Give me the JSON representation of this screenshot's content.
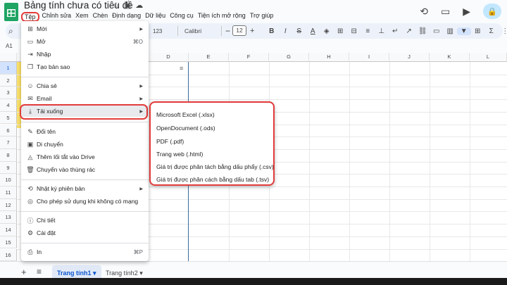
{
  "title_bar": {
    "doc_title": "Bảng tính chưa có tiêu đề",
    "icons": [
      "star-icon",
      "move-folder-icon",
      "cloud-icon"
    ],
    "right_icons": [
      "history-icon",
      "comment-icon",
      "video-icon",
      "lock-icon"
    ]
  },
  "menubar": [
    "Tệp",
    "Chỉnh sửa",
    "Xem",
    "Chèn",
    "Định dạng",
    "Dữ liệu",
    "Công cụ",
    "Tiện ích mở rộng",
    "Trợ giúp"
  ],
  "toolbar": {
    "number_format": "123",
    "font": "Calibri",
    "font_size": "12",
    "minus": "−",
    "plus": "+"
  },
  "name_box": "A1",
  "grid": {
    "columns": [
      "D",
      "E",
      "F",
      "G",
      "H",
      "I",
      "J",
      "K",
      "L"
    ],
    "rows": [
      "1",
      "2",
      "3",
      "4",
      "5",
      "6",
      "7",
      "8",
      "9",
      "10",
      "11",
      "12",
      "13",
      "14",
      "15",
      "16"
    ]
  },
  "sheet_tabs": {
    "active": "Trang tính1",
    "other": "Trang tính2"
  },
  "file_menu": {
    "items": [
      {
        "label": "Mới",
        "icon": "plus-box-icon",
        "kind": "submenu"
      },
      {
        "label": "Mở",
        "icon": "folder-icon",
        "shortcut": "⌘O"
      },
      {
        "label": "Nhập",
        "icon": "import-icon"
      },
      {
        "label": "Tạo bản sao",
        "icon": "copy-icon"
      },
      {
        "label": "Chia sẻ",
        "icon": "share-icon",
        "kind": "submenu"
      },
      {
        "label": "Email",
        "icon": "email-icon",
        "kind": "submenu"
      },
      {
        "label": "Tải xuống",
        "icon": "download-icon",
        "kind": "submenu"
      },
      {
        "label": "Đổi tên",
        "icon": "rename-icon"
      },
      {
        "label": "Di chuyển",
        "icon": "move-icon"
      },
      {
        "label": "Thêm lối tắt vào Drive",
        "icon": "drive-shortcut-icon"
      },
      {
        "label": "Chuyển vào thùng rác",
        "icon": "trash-icon"
      },
      {
        "label": "Nhật ký phiên bản",
        "icon": "history-icon",
        "kind": "submenu"
      },
      {
        "label": "Cho phép sử dụng khi không có mạng",
        "icon": "offline-icon"
      },
      {
        "label": "Chi tiết",
        "icon": "info-icon"
      },
      {
        "label": "Cài đặt",
        "icon": "settings-icon"
      },
      {
        "label": "In",
        "icon": "print-icon",
        "shortcut": "⌘P"
      }
    ]
  },
  "download_submenu": [
    "Microsoft Excel (.xlsx)",
    "OpenDocument (.ods)",
    "PDF (.pdf)",
    "Trang web (.html)",
    "Giá trị được phân tách bằng dấu phẩy (.csv)",
    "Giá trị được phân cách bằng dấu tab (.tsv)"
  ]
}
